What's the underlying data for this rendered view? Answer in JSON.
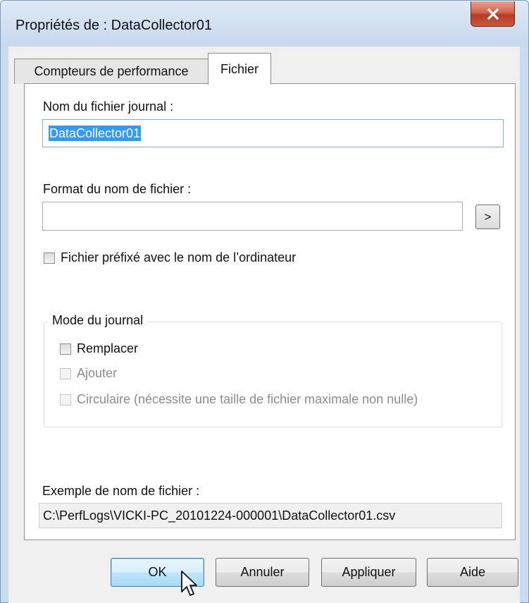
{
  "window": {
    "title": "Propriétés de : DataCollector01"
  },
  "tabs": [
    {
      "label": "Compteurs de performance",
      "active": false
    },
    {
      "label": "Fichier",
      "active": true
    }
  ],
  "file_tab": {
    "log_name_label": "Nom du fichier journal :",
    "log_name_value": "DataCollector01",
    "format_label": "Format du nom de fichier :",
    "format_value": "",
    "browse_button_label": ">",
    "prefix_checkbox": {
      "label": "Fichier préfixé avec le nom de l’ordinateur",
      "checked": false
    },
    "log_mode": {
      "legend": "Mode du journal",
      "options": [
        {
          "label": "Remplacer",
          "checked": false,
          "enabled": true
        },
        {
          "label": "Ajouter",
          "checked": false,
          "enabled": false
        },
        {
          "label": "Circulaire (nécessite une taille de fichier maximale non nulle)",
          "checked": false,
          "enabled": false
        }
      ]
    },
    "example_label": "Exemple de nom de fichier :",
    "example_value": "C:\\PerfLogs\\VICKI-PC_20101224-000001\\DataCollector01.csv"
  },
  "buttons": {
    "ok": "OK",
    "cancel": "Annuler",
    "apply": "Appliquer",
    "help": "Aide"
  },
  "colors": {
    "selection": "#3399ff",
    "close_button": "#c9583f",
    "title_bar": "#c5d8ee"
  }
}
